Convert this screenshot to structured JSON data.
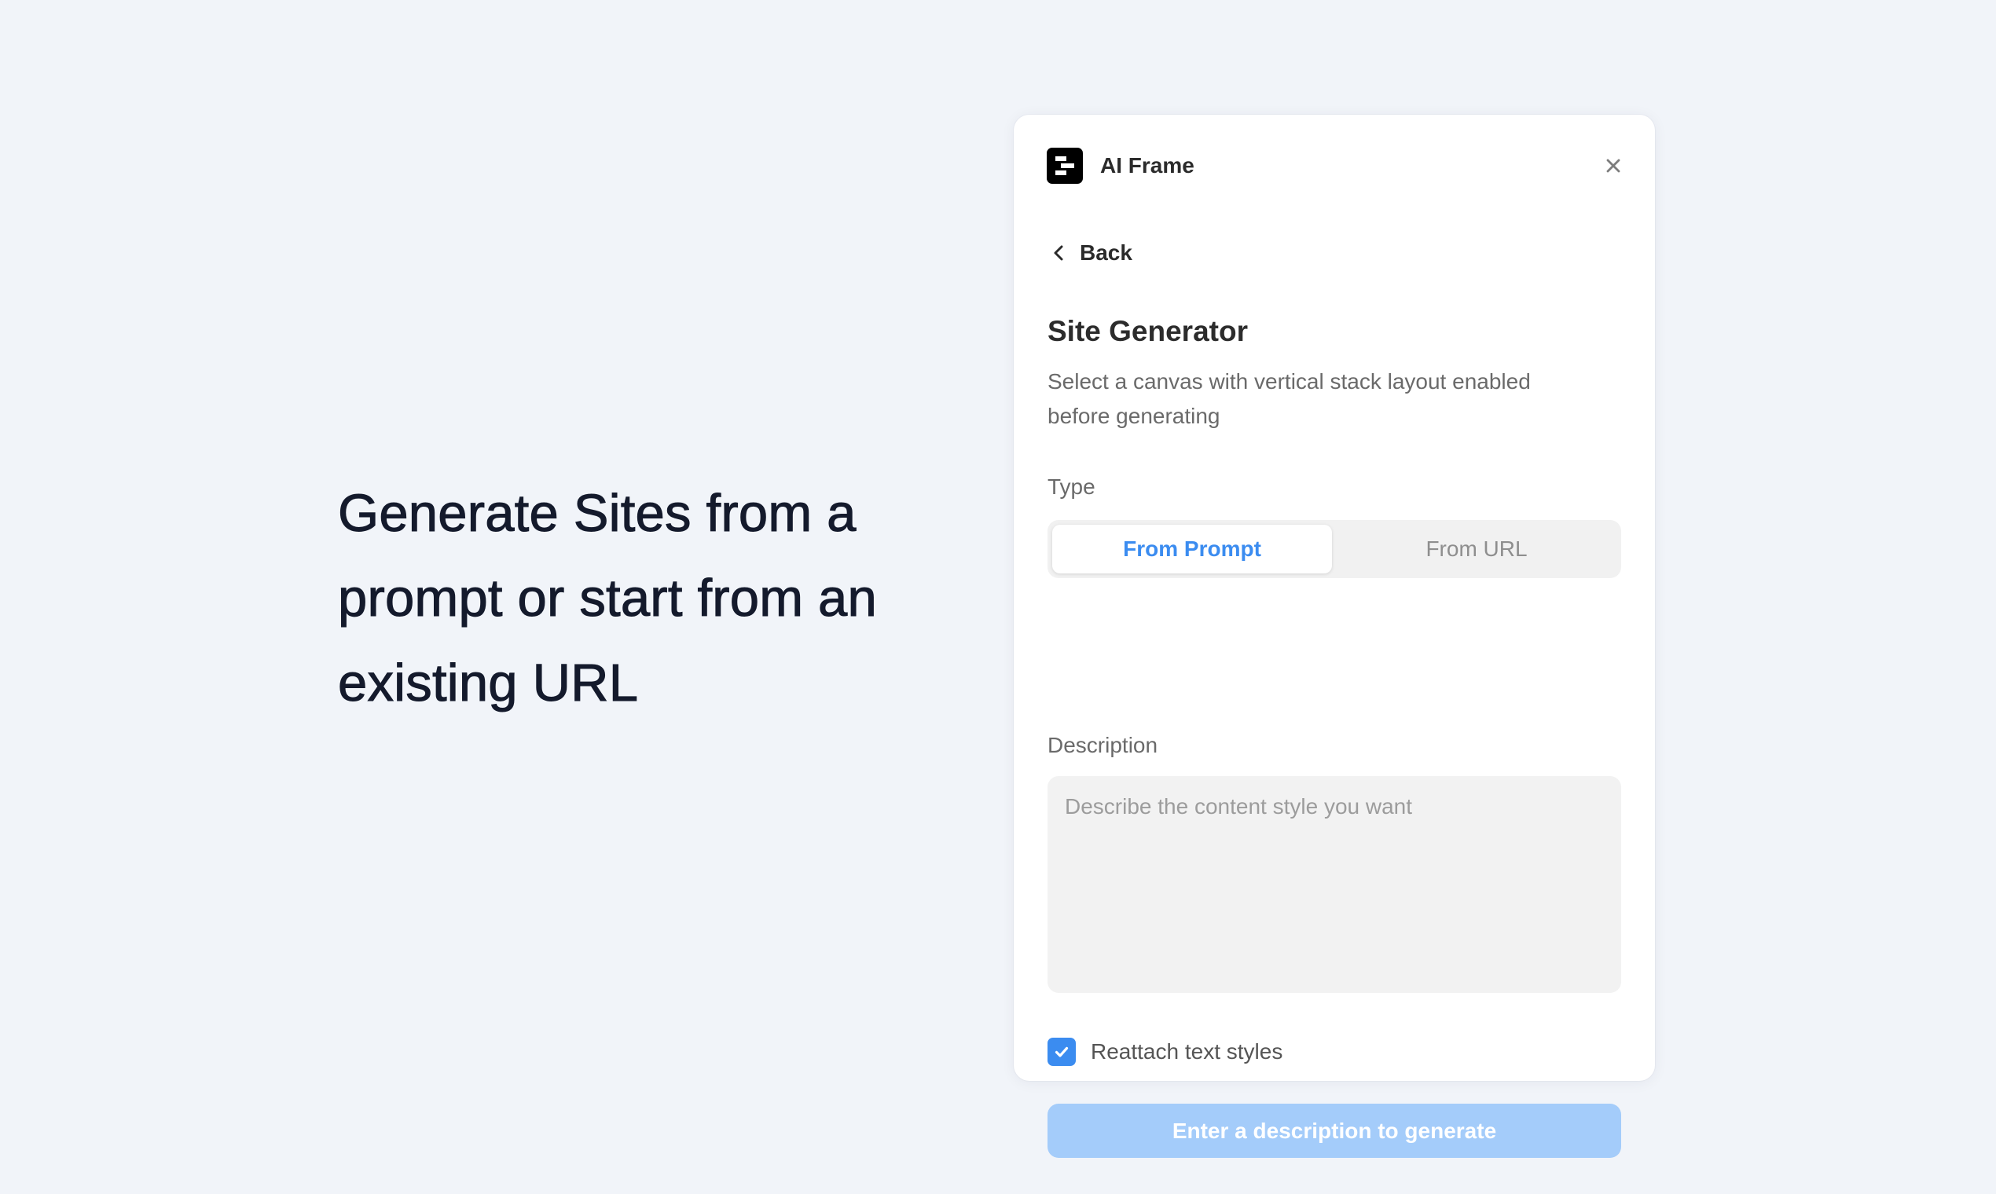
{
  "headline": "Generate Sites from a prompt or start from an existing URL",
  "panel": {
    "app_title": "AI Frame",
    "logo_icon": "ai-frame-logo-icon",
    "close_icon": "close-icon",
    "back": {
      "icon": "chevron-left-icon",
      "label": "Back"
    },
    "section_title": "Site Generator",
    "section_description": "Select a canvas with vertical stack layout enabled before generating",
    "type_label": "Type",
    "type_options": [
      {
        "label": "From Prompt",
        "selected": true
      },
      {
        "label": "From URL",
        "selected": false
      }
    ],
    "description_label": "Description",
    "description_value": "",
    "description_placeholder": "Describe the content style you want",
    "reattach": {
      "checked": true,
      "label": "Reattach text styles"
    },
    "generate_button": {
      "label": "Enter a description to generate",
      "enabled": false
    }
  },
  "colors": {
    "page_background": "#f1f4f9",
    "headline_text": "#141a2c",
    "accent": "#3b8cf0",
    "button_disabled": "#a4ccfa",
    "input_background": "#f2f2f2"
  }
}
